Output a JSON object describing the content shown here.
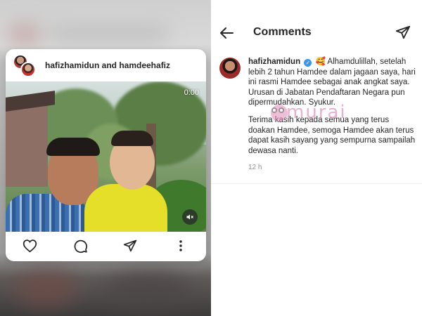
{
  "post": {
    "users": "hafizhamidun and hamdeehafiz",
    "video_time": "0:00"
  },
  "comments_header": {
    "title": "Comments"
  },
  "comment": {
    "username": "hafizhamidun",
    "verified_glyph": "✓",
    "emoji": "🥰",
    "paragraph1": "Alhamdulillah, setelah lebih 2 tahun Hamdee dalam jagaan saya, hari ini rasmi Hamdee sebagai anak angkat saya. Urusan di Jabatan Pendaftaran Negara pun dipermudahkan. Syukur.",
    "paragraph2": "Terima kasih kepada semua yang terus doakan Hamdee, semoga Hamdee akan terus dapat kasih sayang yang sempurna sampailah dewasa nanti.",
    "time": "12 h"
  },
  "watermark": {
    "text": "murai"
  },
  "icons": {
    "like": "heart-icon",
    "comment": "comment-bubble-icon",
    "share": "send-icon",
    "more": "more-vertical-icon",
    "mute": "speaker-muted-icon",
    "back": "arrow-left-icon",
    "dm": "send-icon"
  },
  "colors": {
    "verified": "#3897f0",
    "text": "#262626",
    "muted": "#8e8e8e",
    "watermark": "#d96fa8"
  }
}
